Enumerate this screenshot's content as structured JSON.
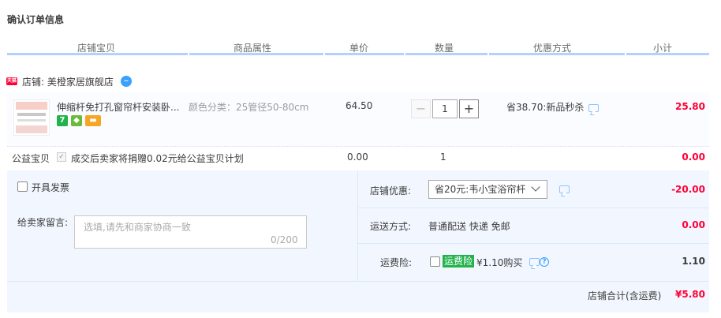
{
  "page": {
    "title": "确认订单信息"
  },
  "columns": [
    "店铺宝贝",
    "商品属性",
    "单价",
    "数量",
    "优惠方式",
    "小计"
  ],
  "shop": {
    "label": "店铺: 美橙家居旗舰店",
    "badge": "天猫"
  },
  "item": {
    "name": "伸缩杆免打孔窗帘杆安装卧...",
    "attr": "颜色分类：25管径50-80cm",
    "price": "64.50",
    "quantity": "1",
    "minus": "−",
    "plus": "+",
    "discount": "省38.70:新品秒杀",
    "subtotal": "25.80",
    "tags": [
      "7"
    ]
  },
  "charity": {
    "label": "公益宝贝",
    "text": "成交后卖家将捐赠0.02元给公益宝贝计划",
    "price": "0.00",
    "quantity": "1",
    "subtotal": "0.00",
    "check": "✓"
  },
  "invoice": {
    "label": "开具发票"
  },
  "message": {
    "label": "给卖家留言:",
    "placeholder": "选填,请先和商家协商一致",
    "count": "0/200"
  },
  "shop_discount": {
    "label": "店铺优惠:",
    "selected": "省20元:韦小宝浴帘杆",
    "amount": "-20.00"
  },
  "shipping": {
    "label": "运送方式:",
    "value": "普通配送 快递 免邮",
    "amount": "0.00"
  },
  "insurance": {
    "label": "运费险:",
    "badge": "运费险",
    "text": "¥1.10购买",
    "amount": "1.10",
    "help": "?"
  },
  "total": {
    "label": "店铺合计(含运费)",
    "amount": "¥5.80"
  },
  "colors": {
    "accent_red": "#ff0036",
    "header_line": "#b2d1ff",
    "panel_bg": "#f2f7ff",
    "insurance_green": "#22b24c"
  }
}
